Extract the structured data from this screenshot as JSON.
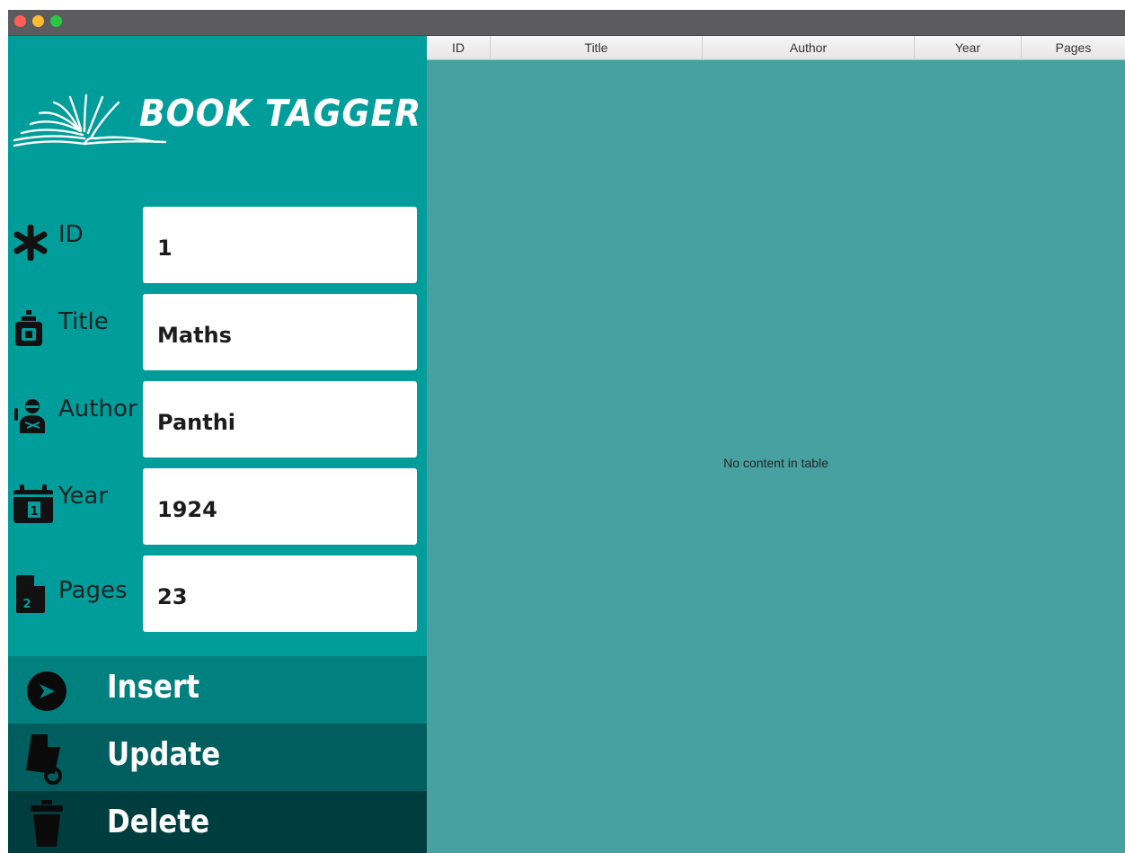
{
  "window": {
    "controls": [
      "close",
      "minimize",
      "zoom"
    ]
  },
  "sidebar": {
    "logo_text": "BOOK TAGGER",
    "fields": [
      {
        "id": "id",
        "label": "ID",
        "value": "1",
        "icon": "asterisk-icon"
      },
      {
        "id": "title",
        "label": "Title",
        "value": "Maths",
        "icon": "bottle-icon"
      },
      {
        "id": "author",
        "label": "Author",
        "value": "Panthi",
        "icon": "person-icon"
      },
      {
        "id": "year",
        "label": "Year",
        "value": "1924",
        "icon": "calendar-icon"
      },
      {
        "id": "pages",
        "label": "Pages",
        "value": "23",
        "icon": "document-icon"
      }
    ],
    "buttons": {
      "insert": "Insert",
      "update": "Update",
      "delete": "Delete"
    }
  },
  "table": {
    "columns": [
      "ID",
      "Title",
      "Author",
      "Year",
      "Pages"
    ],
    "rows": [],
    "empty_message": "No content in table"
  },
  "colors": {
    "sidebar": "#009d9b",
    "insert": "#008180",
    "update": "#005f5e",
    "delete": "#003d3e",
    "table_bg": "#48a1a1"
  }
}
